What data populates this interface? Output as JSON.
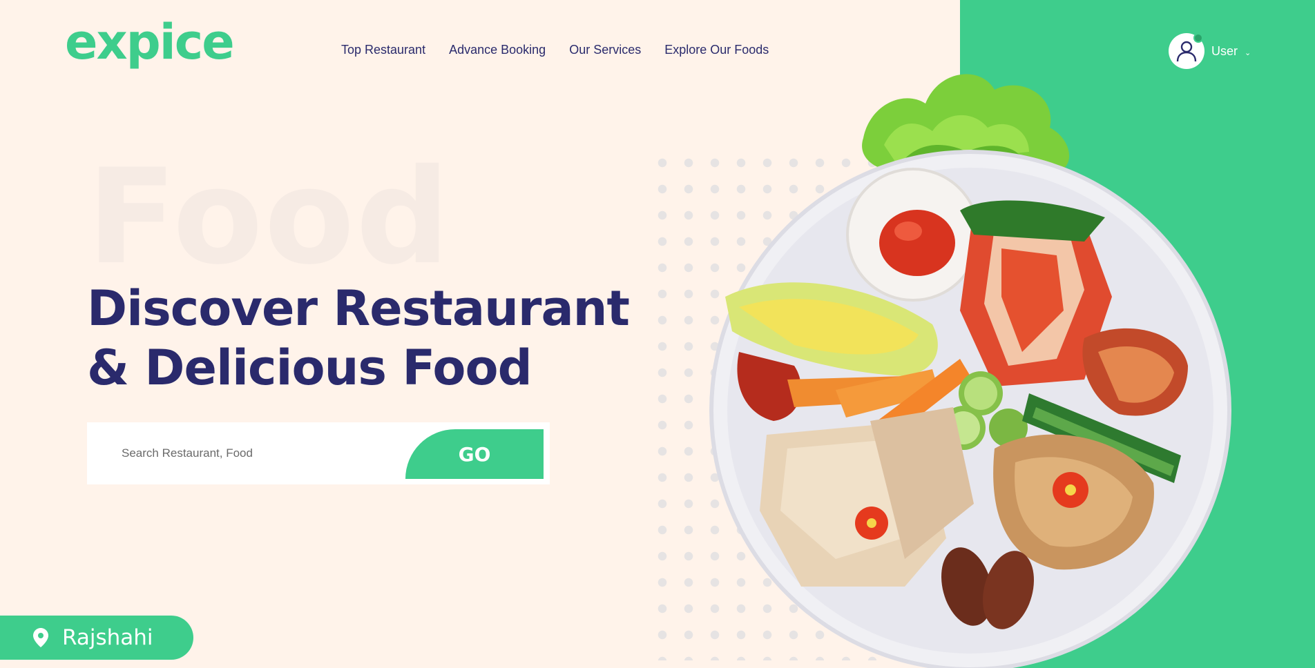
{
  "brand": {
    "logo_text": "expice",
    "accent": "#3ecd8c",
    "dark": "#2a2a6c",
    "background": "#fff3ea"
  },
  "nav": {
    "items": [
      {
        "label": "Top Restaurant"
      },
      {
        "label": "Advance Booking"
      },
      {
        "label": "Our Services"
      },
      {
        "label": "Explore Our Foods"
      }
    ]
  },
  "user": {
    "label": "User",
    "avatar_icon": "user-icon",
    "chevron_icon": "chevron-down-icon",
    "online_badge_color": "#2aa36a"
  },
  "hero": {
    "background_word": "Food",
    "headline_line1": "Discover Restaurant",
    "headline_line2": "& Delicious Food"
  },
  "search": {
    "placeholder": "Search Restaurant, Food",
    "value": "",
    "button_label": "GO"
  },
  "location": {
    "label": "Rajshahi",
    "icon": "map-pin-icon"
  },
  "hero_image": {
    "subject": "plate-of-korean-food",
    "garnish": "lettuce"
  }
}
